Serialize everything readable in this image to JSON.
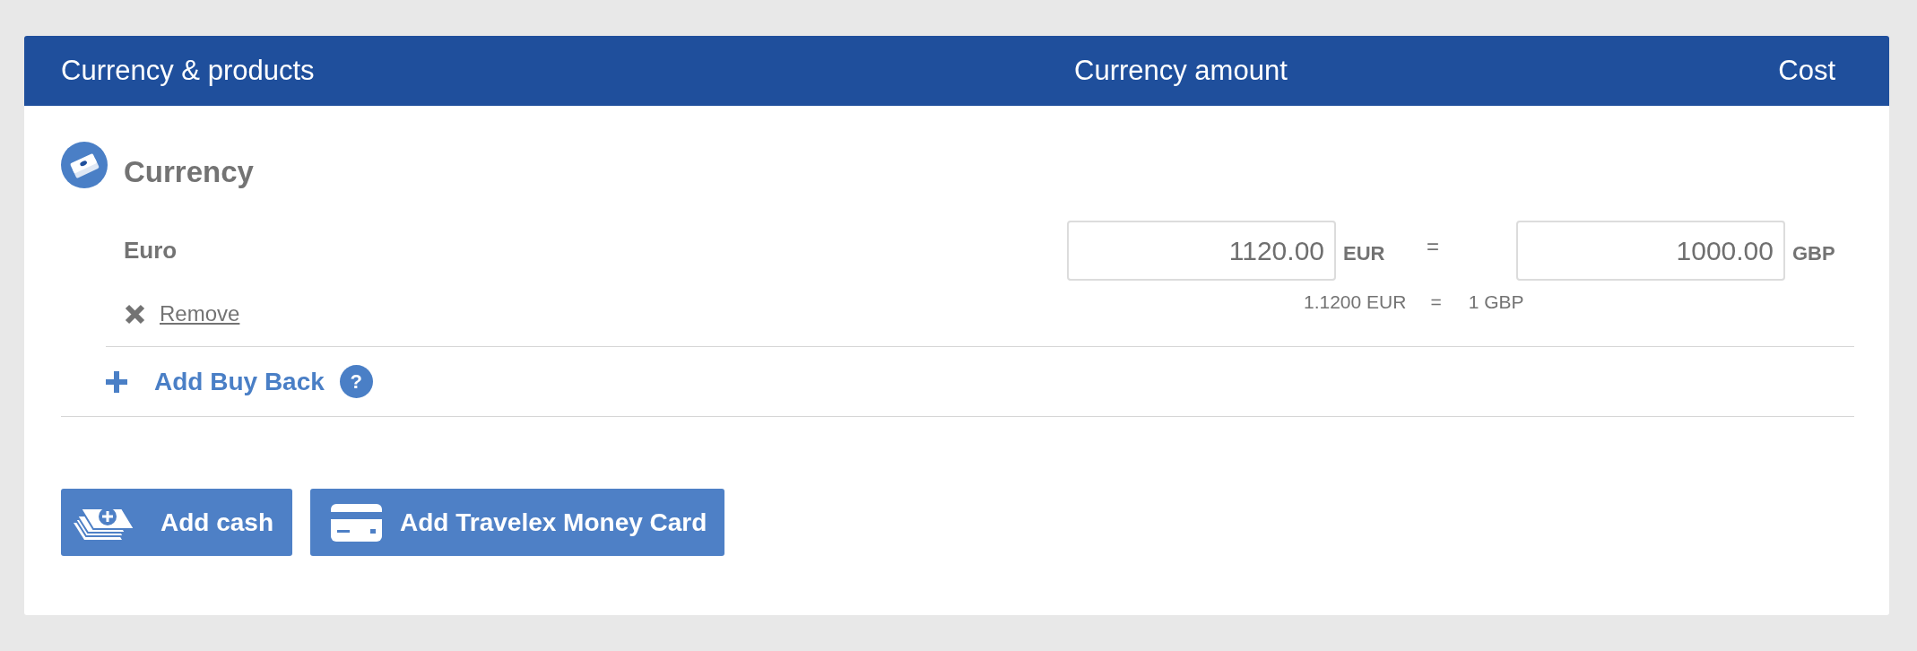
{
  "header": {
    "columns": [
      "Currency & products",
      "Currency amount",
      "Cost"
    ]
  },
  "section": {
    "title": "Currency",
    "items": [
      {
        "name": "Euro",
        "remove_label": "Remove",
        "foreign_amount": "1120.00",
        "foreign_code": "EUR",
        "equals": "=",
        "home_amount": "1000.00",
        "home_code": "GBP",
        "rate": {
          "from": "1.1200 EUR",
          "equals": "=",
          "to": "1 GBP"
        }
      }
    ]
  },
  "buy_back": {
    "label": "Add Buy Back",
    "help": "?"
  },
  "buttons": [
    {
      "kind": "cash",
      "label": "Add cash"
    },
    {
      "kind": "card",
      "label": "Add Travelex Money Card"
    }
  ]
}
